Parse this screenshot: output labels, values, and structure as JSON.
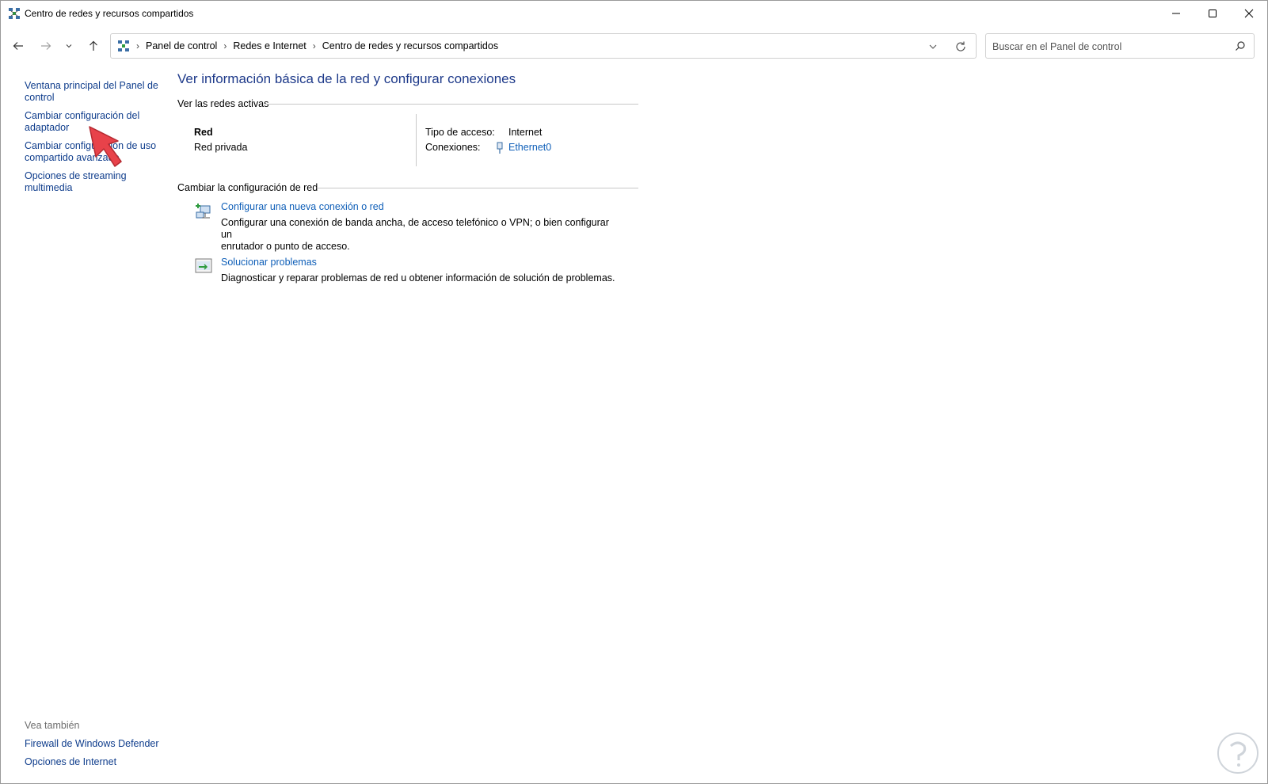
{
  "window": {
    "title": "Centro de redes y recursos compartidos"
  },
  "nav": {
    "breadcrumb": [
      "Panel de control",
      "Redes e Internet",
      "Centro de redes y recursos compartidos"
    ],
    "search_placeholder": "Buscar en el Panel de control"
  },
  "left_pane": {
    "links": [
      "Ventana principal del Panel de control",
      "Cambiar configuración del adaptador",
      "Cambiar configuración de uso compartido avanzado",
      "Opciones de streaming multimedia"
    ],
    "see_also_heading": "Vea también",
    "see_also_links": [
      "Firewall de Windows Defender",
      "Opciones de Internet"
    ]
  },
  "main": {
    "title": "Ver información básica de la red y configurar conexiones",
    "active_networks_heading": "Ver las redes activas",
    "network": {
      "name": "Red",
      "type": "Red privada",
      "access_type_label": "Tipo de acceso:",
      "access_type_value": "Internet",
      "connections_label": "Conexiones:",
      "connection_value": "Ethernet0"
    },
    "change_heading": "Cambiar la configuración de red",
    "tasks": [
      {
        "link": "Configurar una nueva conexión o red",
        "desc_line1": "Configurar una conexión de banda ancha, de acceso telefónico o VPN; o bien configurar un",
        "desc_line2": "enrutador o punto de acceso.",
        "icon": "new-connection-icon"
      },
      {
        "link": "Solucionar problemas",
        "desc_line1": "Diagnosticar y reparar problemas de red u obtener información de solución de problemas.",
        "icon": "troubleshoot-icon"
      }
    ]
  },
  "colors": {
    "link": "#0f5fb8",
    "heading": "#1e3a8a",
    "annotation_arrow": "#e8424a"
  }
}
